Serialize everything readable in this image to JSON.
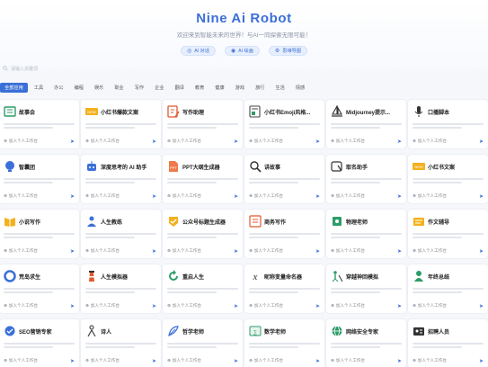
{
  "header": {
    "title": "Nine Ai Robot",
    "subtitle": "欢迎来到智能未来的世界！与AI一同探索无限可能！",
    "pills": [
      {
        "label": "AI 对话",
        "icon": "chat-icon"
      },
      {
        "label": "AI 绘画",
        "icon": "paint-icon"
      },
      {
        "label": "思维导图",
        "icon": "mindmap-icon"
      }
    ]
  },
  "search": {
    "placeholder": "请输入关键词"
  },
  "tabs": [
    "全部应用",
    "工具",
    "办公",
    "编程",
    "娱乐",
    "职业",
    "写作",
    "企业",
    "翻译",
    "教育",
    "健康",
    "游戏",
    "旅行",
    "生活",
    "情感"
  ],
  "card_add_label": "加入个人工作台",
  "cards": [
    {
      "title": "故事会",
      "icon": "book-icon"
    },
    {
      "title": "小红书爆款文案",
      "icon": "notes-icon"
    },
    {
      "title": "写作助理",
      "icon": "edit-icon"
    },
    {
      "title": "小红书Emoji风格...",
      "icon": "document-icon"
    },
    {
      "title": "Midjourney提示...",
      "icon": "sailboat-icon"
    },
    {
      "title": "口播脚本",
      "icon": "microphone-icon"
    },
    {
      "title": "智囊团",
      "icon": "bulb-icon"
    },
    {
      "title": "深度思考的 AI 助手",
      "icon": "robot-icon"
    },
    {
      "title": "PPT大纲生成器",
      "icon": "ppt-icon"
    },
    {
      "title": "讲故事",
      "icon": "magnifier-icon"
    },
    {
      "title": "取名助手",
      "icon": "tag-icon"
    },
    {
      "title": "小红书文案",
      "icon": "notes-icon"
    },
    {
      "title": "小说写作",
      "icon": "book-open-icon"
    },
    {
      "title": "人生教练",
      "icon": "coach-icon"
    },
    {
      "title": "公众号标题生成器",
      "icon": "badge-icon"
    },
    {
      "title": "商务写作",
      "icon": "pen-icon"
    },
    {
      "title": "物理老师",
      "icon": "physics-icon"
    },
    {
      "title": "作文辅导",
      "icon": "essay-icon"
    },
    {
      "title": "荒岛求生",
      "icon": "lifebuoy-icon"
    },
    {
      "title": "人生模拟器",
      "icon": "lighthouse-icon"
    },
    {
      "title": "重启人生",
      "icon": "restart-icon"
    },
    {
      "title": "昵称变量命名器",
      "icon": "variable-icon"
    },
    {
      "title": "穿越神回模拟",
      "icon": "travel-icon"
    },
    {
      "title": "年终总结",
      "icon": "person-icon"
    },
    {
      "title": "SEO营销专家",
      "icon": "seo-icon"
    },
    {
      "title": "诗人",
      "icon": "poet-icon"
    },
    {
      "title": "哲学老师",
      "icon": "feather-icon"
    },
    {
      "title": "数学老师",
      "icon": "math-icon"
    },
    {
      "title": "网络安全专家",
      "icon": "globe-icon"
    },
    {
      "title": "招聘人员",
      "icon": "recruit-icon"
    }
  ],
  "colors": {
    "accent": "#3b6fd8",
    "background": "#f5f7fb",
    "card": "#ffffff"
  }
}
